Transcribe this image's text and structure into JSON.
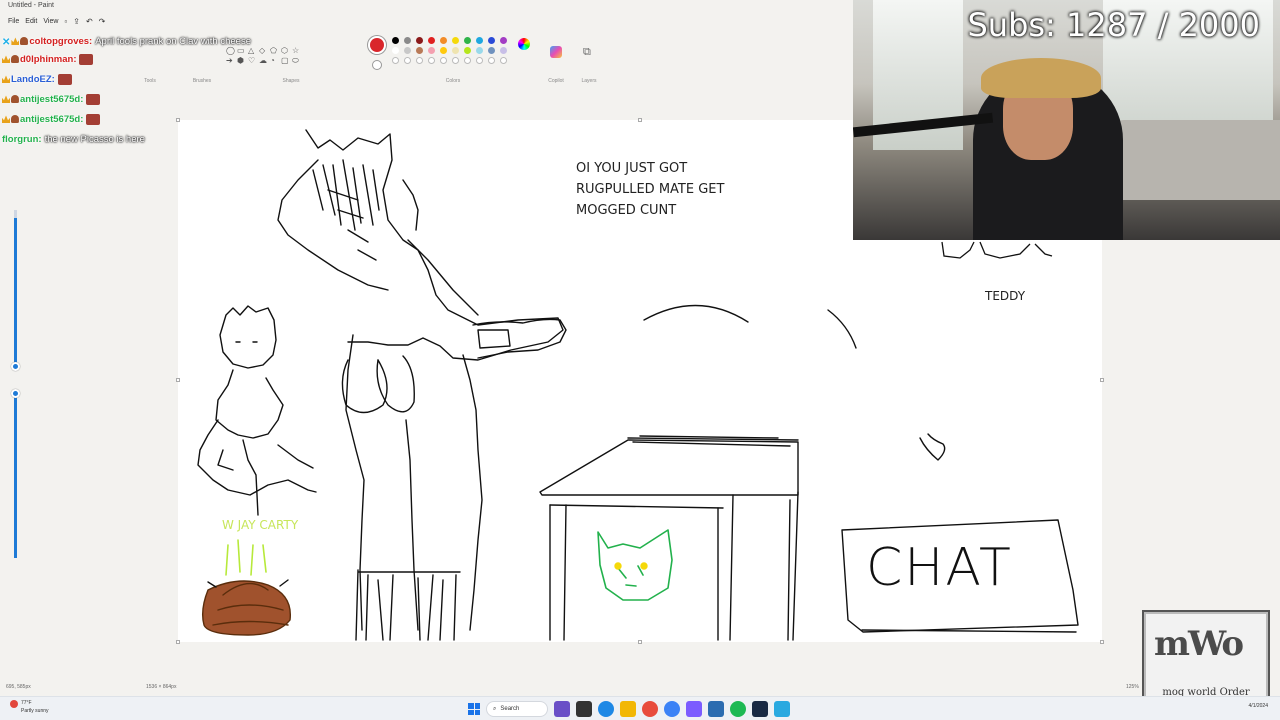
{
  "app": {
    "window_title": "Untitled - Paint",
    "menu": [
      "File",
      "Edit",
      "View"
    ]
  },
  "ribbon": {
    "groups": [
      "Tools",
      "Brushes",
      "Shapes",
      "Colors",
      "Copilot",
      "Layers"
    ],
    "selected_color": "#d9262b",
    "palette": [
      "#000000",
      "#8a8a8a",
      "#8b1a1a",
      "#e02020",
      "#f28c28",
      "#f5d90a",
      "#2fb44a",
      "#1fa8e0",
      "#2a4bd7",
      "#a33cc4",
      "#ffffff",
      "#c8c8c8",
      "#b97a57",
      "#f4a0b0",
      "#ffc90e",
      "#efe4b0",
      "#b5e61d",
      "#99d9ea",
      "#7092be",
      "#c8bfe7",
      "",
      "",
      "",
      "",
      "",
      "",
      "",
      "",
      "",
      ""
    ]
  },
  "chat": [
    {
      "user": "coltopgroves",
      "user_color": "#d4201f",
      "text": "April fools prank on Clav with cheese",
      "badges": [
        "cross",
        "crown",
        "heart"
      ]
    },
    {
      "user": "d0lphinman",
      "user_color": "#d4201f",
      "text": "",
      "badges": [
        "crown",
        "heart"
      ],
      "emote": true
    },
    {
      "user": "LandoEZ",
      "user_color": "#2a5fd6",
      "text": "",
      "badges": [
        "crown"
      ],
      "emote": true
    },
    {
      "user": "antijest5675d",
      "user_color": "#22b14c",
      "text": "",
      "badges": [
        "crown",
        "heart"
      ],
      "emote": true
    },
    {
      "user": "antijest5675d",
      "user_color": "#22b14c",
      "text": "",
      "badges": [
        "crown",
        "heart"
      ],
      "emote": true
    },
    {
      "user": "florgrun",
      "user_color": "#22b14c",
      "text": "the new Picasso is here",
      "badges": []
    }
  ],
  "canvas": {
    "caption_lines": [
      "OI YOU JUST GOT",
      "RUGPULLED MATE GET",
      "MOGGED CUNT"
    ],
    "teddy_label": "TEDDY",
    "chat_box_label": "CHAT",
    "carty_label": "W JAY CARTY"
  },
  "webcam": {
    "subs_text": "Subs: 1287 / 2000"
  },
  "logo": {
    "mark": "mWo",
    "text": "moq world Order"
  },
  "statusbar": {
    "position": "695, 585px",
    "canvas_size": "1536 × 864px",
    "zoom": "125%"
  },
  "taskbar": {
    "weather_temp": "77°F",
    "weather_desc": "Partly sunny",
    "search_label": "Search",
    "date": "4/1/2024"
  }
}
